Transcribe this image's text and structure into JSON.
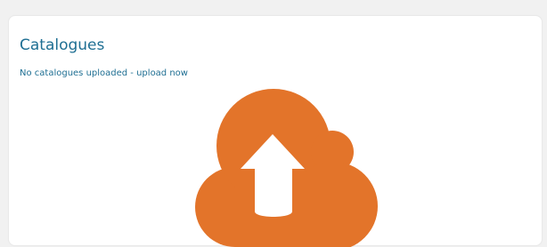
{
  "card": {
    "title": "Catalogues",
    "upload_link_text": "No catalogues uploaded - upload now"
  },
  "upload_icon": {
    "name": "cloud-upload-icon",
    "color": "#e3742a",
    "arrow_color": "#ffffff"
  },
  "colors": {
    "page_background": "#f1f1f1",
    "card_background": "#ffffff",
    "text_accent": "#1f6f93"
  }
}
